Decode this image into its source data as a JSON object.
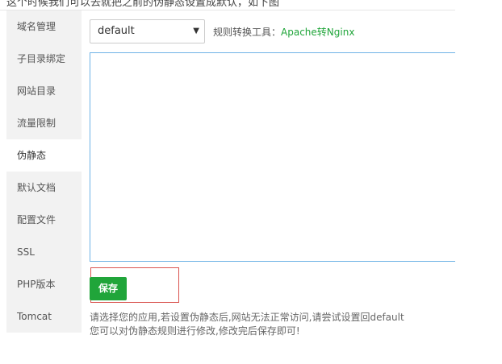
{
  "top_caption": "这个时候我们可以去就把之前的伪静态设置成默认，如下图",
  "sidebar": {
    "items": [
      {
        "label": "域名管理",
        "active": false
      },
      {
        "label": "子目录绑定",
        "active": false
      },
      {
        "label": "网站目录",
        "active": false
      },
      {
        "label": "流量限制",
        "active": false
      },
      {
        "label": "伪静态",
        "active": true
      },
      {
        "label": "默认文档",
        "active": false
      },
      {
        "label": "配置文件",
        "active": false
      },
      {
        "label": "SSL",
        "active": false
      },
      {
        "label": "PHP版本",
        "active": false
      },
      {
        "label": "Tomcat",
        "active": false
      }
    ]
  },
  "rewrite": {
    "select_value": "default",
    "tool_label": "规则转换工具：",
    "tool_link": "Apache转Nginx",
    "editor_content": "",
    "save_label": "保存",
    "help_line_1": "请选择您的应用,若设置伪静态后,网站无法正常访问,请尝试设置回default",
    "help_line_2": "您可以对伪静态规则进行修改,修改完后保存即可!"
  },
  "colors": {
    "accent_green": "#20a53a",
    "editor_border": "#6fb3e6",
    "highlight_red": "#d9534f",
    "sidebar_bg": "#f2f2f2"
  }
}
